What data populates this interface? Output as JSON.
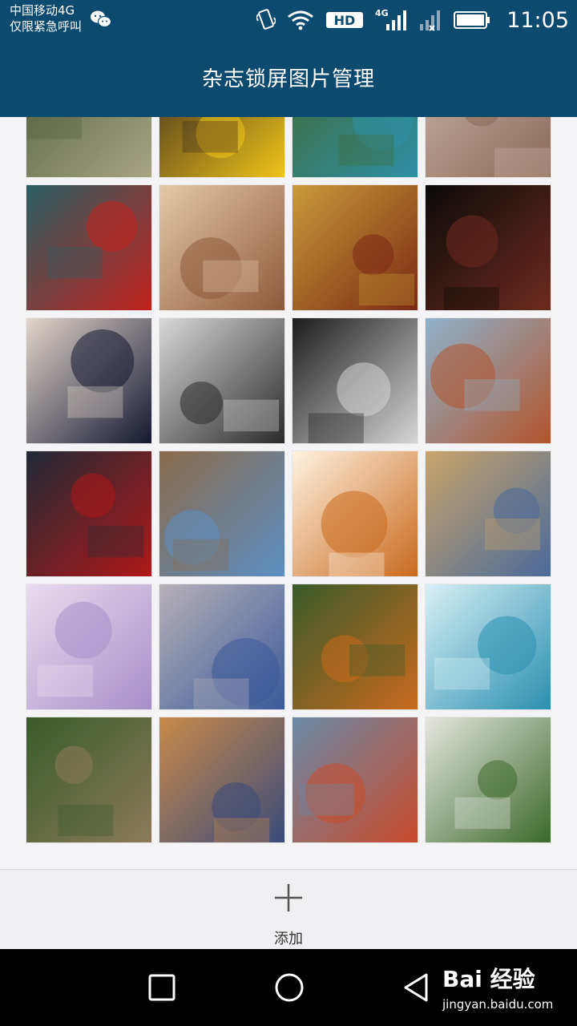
{
  "status_bar": {
    "carrier_line1": "中国移动4G",
    "carrier_line2": "仅限紧急呼叫",
    "network_label": "4G",
    "hd_label": "HD",
    "time": "11:05"
  },
  "app_bar": {
    "title": "杂志锁屏图片管理"
  },
  "gallery": {
    "thumbnails": [
      {
        "name": "table-glasses",
        "c1": "#a7a585",
        "c2": "#54613f"
      },
      {
        "name": "yellow-bowl",
        "c1": "#f0c41a",
        "c2": "#3b2a1e"
      },
      {
        "name": "teal-flowers",
        "c1": "#2e8fa6",
        "c2": "#3f6a33"
      },
      {
        "name": "wood-petals",
        "c1": "#8a6a58",
        "c2": "#c9b3a6"
      },
      {
        "name": "red-flowers",
        "c1": "#c2221e",
        "c2": "#2a5f63"
      },
      {
        "name": "tea-set",
        "c1": "#8c5a3c",
        "c2": "#e4c9a8"
      },
      {
        "name": "golf-clubs",
        "c1": "#7a2a12",
        "c2": "#c99a3a"
      },
      {
        "name": "violin",
        "c1": "#6e2a1e",
        "c2": "#0a0a0a"
      },
      {
        "name": "dinner-table",
        "c1": "#141830",
        "c2": "#e2d6cc"
      },
      {
        "name": "engine",
        "c1": "#2a2a2a",
        "c2": "#d9d9d9"
      },
      {
        "name": "arch-bw",
        "c1": "#d6d6d6",
        "c2": "#1c1c1c"
      },
      {
        "name": "desert-rocks",
        "c1": "#b2542b",
        "c2": "#8fb2cc"
      },
      {
        "name": "temple-roof",
        "c1": "#b01818",
        "c2": "#1f2a36"
      },
      {
        "name": "river-castle",
        "c1": "#5c8fc4",
        "c2": "#8a6a4a"
      },
      {
        "name": "escalator",
        "c1": "#c96a1e",
        "c2": "#fff2e0"
      },
      {
        "name": "metal-building",
        "c1": "#4a6a9a",
        "c2": "#c9a46a"
      },
      {
        "name": "purple-forest",
        "c1": "#a68fc8",
        "c2": "#eadcf0"
      },
      {
        "name": "lake-driftwood",
        "c1": "#3a5a9a",
        "c2": "#b8b0b8"
      },
      {
        "name": "autumn-hills",
        "c1": "#c96a1e",
        "c2": "#3a5a2a"
      },
      {
        "name": "wave",
        "c1": "#2a8fb0",
        "c2": "#d8f0f6"
      },
      {
        "name": "village-street",
        "c1": "#8a7a5a",
        "c2": "#3a5a2a"
      },
      {
        "name": "canal-houses",
        "c1": "#3a4a7a",
        "c2": "#c98a4a"
      },
      {
        "name": "old-town",
        "c1": "#c94a2a",
        "c2": "#6a8aa8"
      },
      {
        "name": "mossy-waterfall",
        "c1": "#3a6a2a",
        "c2": "#e6e6e0"
      }
    ]
  },
  "bottom_bar": {
    "add_label": "添加"
  },
  "watermark": {
    "main": "Bai 经验",
    "sub": "jingyan.baidu.com"
  },
  "colors": {
    "primary": "#0d4a6f",
    "nav_background": "#000000",
    "page_background": "#f4f4f6"
  },
  "icons": [
    "wechat-icon",
    "vibrate-icon",
    "wifi-icon",
    "hd-icon",
    "signal-icon",
    "no-sim-signal-icon",
    "battery-icon",
    "plus-icon",
    "recent-apps-icon",
    "home-icon",
    "back-icon"
  ]
}
